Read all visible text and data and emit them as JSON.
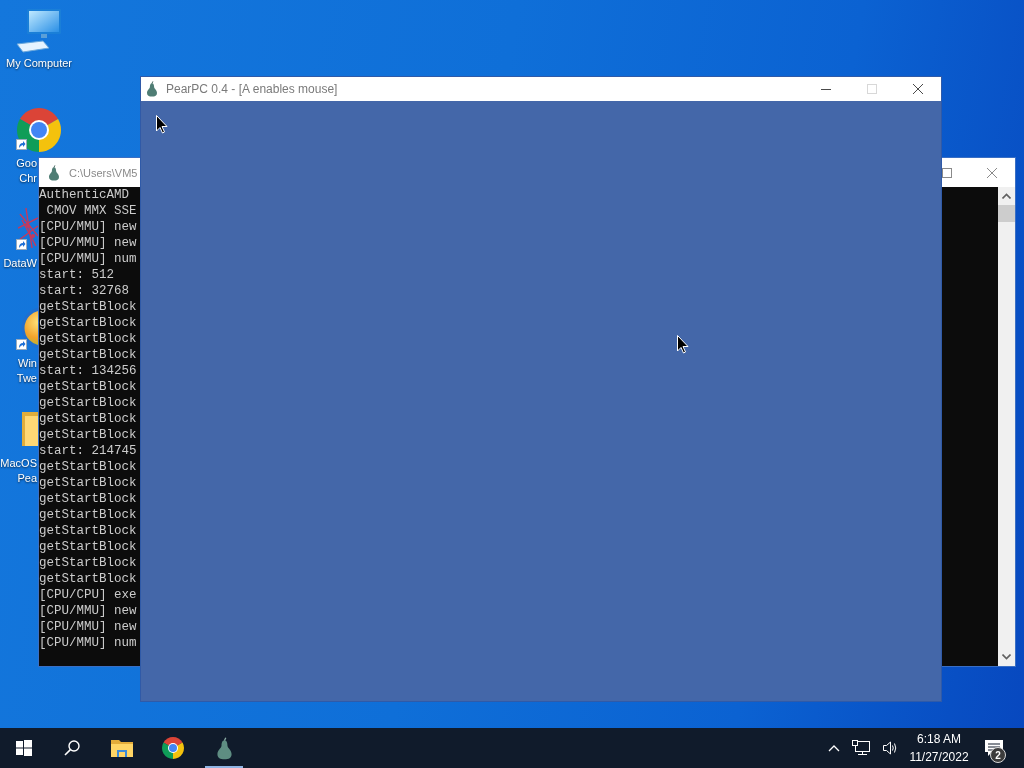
{
  "desktop_icons": [
    {
      "kind": "computer",
      "label_lines": [
        "My Computer"
      ],
      "shortcut": false
    },
    {
      "kind": "chrome",
      "label_lines": [
        "Goo",
        "Chr"
      ],
      "shortcut": true
    },
    {
      "kind": "network",
      "label_lines": [
        "DataW"
      ],
      "shortcut": true
    },
    {
      "kind": "orb",
      "label_lines": [
        "Win",
        "Twe"
      ],
      "shortcut": true
    },
    {
      "kind": "folder",
      "label_lines": [
        "MacOS",
        "Pea"
      ],
      "shortcut": false
    }
  ],
  "console_window": {
    "title": "C:\\Users\\VM5",
    "lines": [
      "AuthenticAMD",
      " CMOV MMX SSE",
      "[CPU/MMU] new",
      "[CPU/MMU] new",
      "[CPU/MMU] num",
      "start: 512",
      "start: 32768",
      "getStartBlock",
      "getStartBlock",
      "getStartBlock",
      "getStartBlock",
      "start: 134256",
      "getStartBlock",
      "getStartBlock",
      "getStartBlock",
      "getStartBlock",
      "start: 214745",
      "getStartBlock",
      "getStartBlock",
      "getStartBlock",
      "getStartBlock",
      "getStartBlock",
      "getStartBlock",
      "getStartBlock",
      "getStartBlock",
      "[CPU/CPU] exe",
      "[CPU/MMU] new",
      "[CPU/MMU] new",
      "[CPU/MMU] num"
    ],
    "buttons": [
      {
        "kind": "maximize",
        "disabled": false
      },
      {
        "kind": "close",
        "disabled": false
      }
    ]
  },
  "emulator_window": {
    "title": "PearPC 0.4 - [A enables mouse]",
    "buttons": [
      {
        "kind": "minimize",
        "disabled": false
      },
      {
        "kind": "maximize",
        "disabled": true
      },
      {
        "kind": "close",
        "disabled": false
      }
    ]
  },
  "taskbar": {
    "apps": [
      {
        "kind": "explorer",
        "running": false
      },
      {
        "kind": "chrome",
        "running": false
      },
      {
        "kind": "pear",
        "running": true
      }
    ],
    "clock": {
      "time": "6:18 AM",
      "date": "11/27/2022"
    },
    "notifications": {
      "count": "2"
    }
  }
}
